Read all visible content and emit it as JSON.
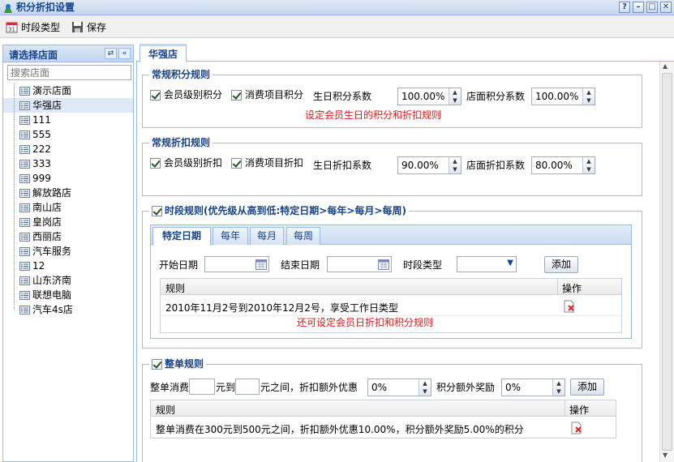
{
  "window": {
    "title": "积分折扣设置",
    "help_btn": "?",
    "min_btn": "–",
    "max_btn": "□",
    "close_btn": "✕"
  },
  "toolbar": {
    "period_type_label": "时段类型",
    "save_label": "保存"
  },
  "left": {
    "header": "请选择店面",
    "search_placeholder": "搜索店面",
    "stores": [
      "演示店面",
      "华强店",
      "111",
      "555",
      "222",
      "333",
      "999",
      "解放路店",
      "南山店",
      "皇岗店",
      "西丽店",
      "汽车服务",
      "12",
      "山东济南",
      "联想电脑",
      "汽车4s店"
    ],
    "selected_index": 1
  },
  "tab": {
    "label": "华强店"
  },
  "points": {
    "legend": "常规积分规则",
    "member_level_label": "会员级别积分",
    "item_label": "消费项目积分",
    "birthday_label": "生日积分系数",
    "birthday_value": "100.00%",
    "store_label": "店面积分系数",
    "store_value": "100.00%",
    "note": "设定会员生日的积分和折扣规则"
  },
  "discount": {
    "legend": "常规折扣规则",
    "member_level_label": "会员级别折扣",
    "item_label": "消费项目折扣",
    "birthday_label": "生日折扣系数",
    "birthday_value": "90.00%",
    "store_label": "店面折扣系数",
    "store_value": "80.00%"
  },
  "period": {
    "legend": "时段规则(优先级从高到低:特定日期>每年>每月>每周)",
    "tabs": [
      "特定日期",
      "每年",
      "每月",
      "每周"
    ],
    "start_label": "开始日期",
    "end_label": "结束日期",
    "type_label": "时段类型",
    "add_label": "添加",
    "col_rule": "规则",
    "col_op": "操作",
    "rows": [
      "2010年11月2号到2010年12月2号，享受工作日类型"
    ],
    "note": "还可设定会员日折扣和积分规则"
  },
  "whole": {
    "legend": "整单规则",
    "consume_label": "整单消费",
    "to_label": "元到",
    "between_label": "元之间，折扣额外优惠",
    "discount_value": "0%",
    "bonus_label": "积分额外奖励",
    "bonus_value": "0%",
    "add_label": "添加",
    "col_rule": "规则",
    "col_op": "操作",
    "rows": [
      "整单消费在300元到500元之间，折扣额外优惠10.00%，积分额外奖励5.00%的积分"
    ]
  }
}
